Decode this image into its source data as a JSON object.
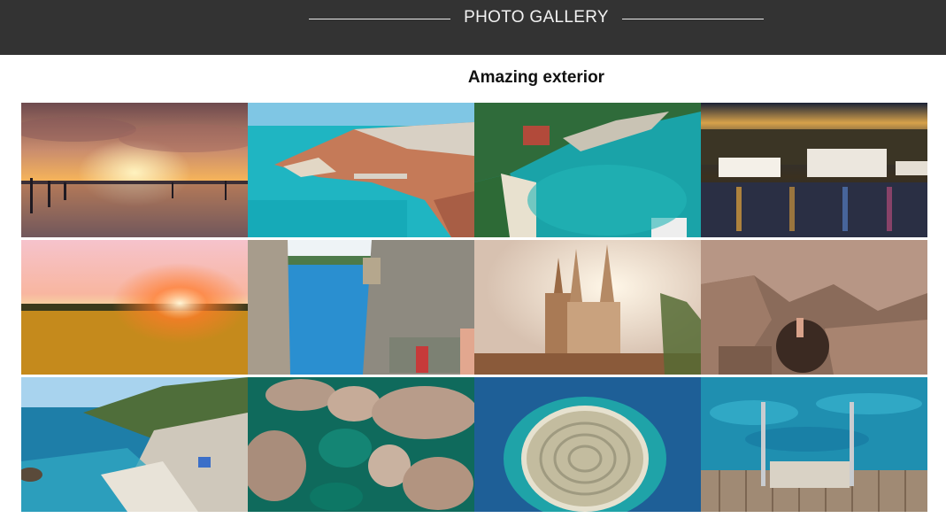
{
  "header": {
    "title": "PHOTO GALLERY"
  },
  "section": {
    "title": "Amazing exterior"
  },
  "colors": {
    "header_bg": "#333333",
    "header_text": "#f2f2f2"
  },
  "photos": [
    {
      "name": "sunset-reflection-beach"
    },
    {
      "name": "old-town-harbor-aerial"
    },
    {
      "name": "turquoise-cove-aerial"
    },
    {
      "name": "night-harbor-cruise-ships"
    },
    {
      "name": "sunflower-field-sunset"
    },
    {
      "name": "narrow-alley-sea-view"
    },
    {
      "name": "cathedral-spires"
    },
    {
      "name": "rock-cliff-climber"
    },
    {
      "name": "rocky-beach-bay"
    },
    {
      "name": "rocks-turquoise-water-aerial"
    },
    {
      "name": "fingerprint-island-aerial"
    },
    {
      "name": "pool-ladder-dock"
    }
  ]
}
